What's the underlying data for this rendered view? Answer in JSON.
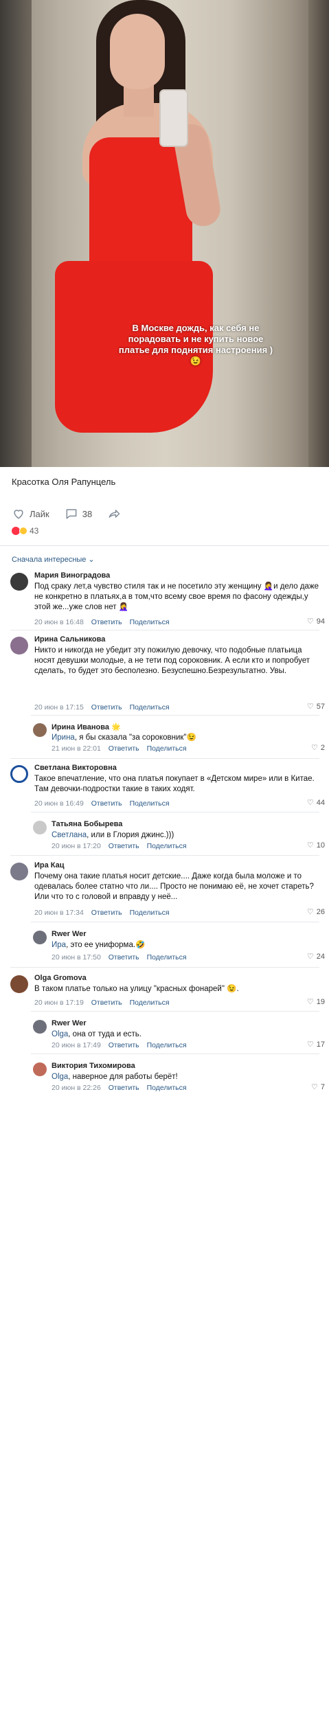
{
  "post": {
    "caption": "В Москве дождь, как себя не порадовать и не купить новое платье для поднятия настроения )😉",
    "title": "Красотка Оля Рапунцель",
    "like_label": "Лайк",
    "comments_count": "38",
    "reactions_count": "43",
    "sort_label": "Сначала интересные"
  },
  "comments": [
    {
      "author": "Мария Виноградова",
      "text": "Под сраку лет,а чувство стиля так и не посетило эту женщину 🤦‍♀️и дело даже не конкретно в платьях,а в том,что всему свое время по фасону одежды,у этой же...уже слов нет 🤦‍♀️",
      "date": "20 июн в 16:48",
      "reply": "Ответить",
      "share": "Поделиться",
      "likes": "94",
      "avatar_color": "#3a3a3a"
    },
    {
      "author": "Ирина Сальникова",
      "text": "Никто и никогда не убедит эту пожилую девочку, что подобные платьица носят девушки молодые, а не тети под сороковник. А если кто и попробует сделать, то будет это бесполезно. Безуспешно.Безрезультатно. Увы.",
      "date": "20 июн в 17:15",
      "reply": "Ответить",
      "share": "Поделиться",
      "likes": "57",
      "avatar_color": "#8a6f8e"
    },
    {
      "author": "Ирина Иванова 🌟",
      "mention": "Ирина",
      "text": ", я бы сказала \"за сороковник\"😉",
      "date": "21 июн в 22:01",
      "reply": "Ответить",
      "share": "Поделиться",
      "likes": "2",
      "avatar_color": "#8b6a55"
    },
    {
      "author": "Светлана Викторовна",
      "text": "Такое впечатление, что она платья покупает в «Детском мире» или в Китае. Там девочки-подростки такие в таких ходят.",
      "date": "20 июн в 16:49",
      "reply": "Ответить",
      "share": "Поделиться",
      "likes": "44",
      "avatar_color": "#1b4f9c"
    },
    {
      "author": "Татьяна Бобырева",
      "mention": "Светлана",
      "text": ", или в Глория джинс.)))",
      "date": "20 июн в 17:20",
      "reply": "Ответить",
      "share": "Поделиться",
      "likes": "10",
      "avatar_color": "#c9c9c9"
    },
    {
      "author": "Ира Кац",
      "text": "Почему она такие платья носит детские.... Даже когда была моложе и то одевалась более статно что ли.... Просто не понимаю её, не хочет стареть? Или что то с головой и вправду у неё...",
      "date": "20 июн в 17:34",
      "reply": "Ответить",
      "share": "Поделиться",
      "likes": "26",
      "avatar_color": "#7a7a8a"
    },
    {
      "author": "Rwer Wer",
      "mention": "Ира",
      "text": ", это ее униформа.🤣",
      "date": "20 июн в 17:50",
      "reply": "Ответить",
      "share": "Поделиться",
      "likes": "24",
      "avatar_color": "#6d6f7a"
    },
    {
      "author": "Olga Gromova",
      "text": "В таком платье только на улицу \"красных фонарей\" 😉.",
      "date": "20 июн в 17:19",
      "reply": "Ответить",
      "share": "Поделиться",
      "likes": "19",
      "avatar_color": "#7b4a32"
    },
    {
      "author": "Rwer Wer",
      "mention": "Olga",
      "text": ", она от туда и есть.",
      "date": "20 июн в 17:49",
      "reply": "Ответить",
      "share": "Поделиться",
      "likes": "17",
      "avatar_color": "#6d6f7a"
    },
    {
      "author": "Виктория Тихомирова",
      "mention": "Olga",
      "text": ", наверное для работы берёт!",
      "date": "20 июн в 22:26",
      "reply": "Ответить",
      "share": "Поделиться",
      "likes": "7",
      "avatar_color": "#c06a5a"
    }
  ]
}
